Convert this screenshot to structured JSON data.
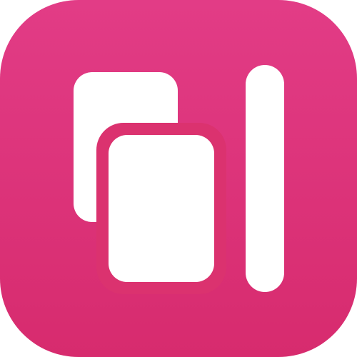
{
  "app_icon": {
    "name": "stacked-cards-with-bar",
    "colors": {
      "background_top": "#E23C86",
      "background_bottom": "#D72B6E",
      "glyph": "#FFFFFF"
    }
  }
}
